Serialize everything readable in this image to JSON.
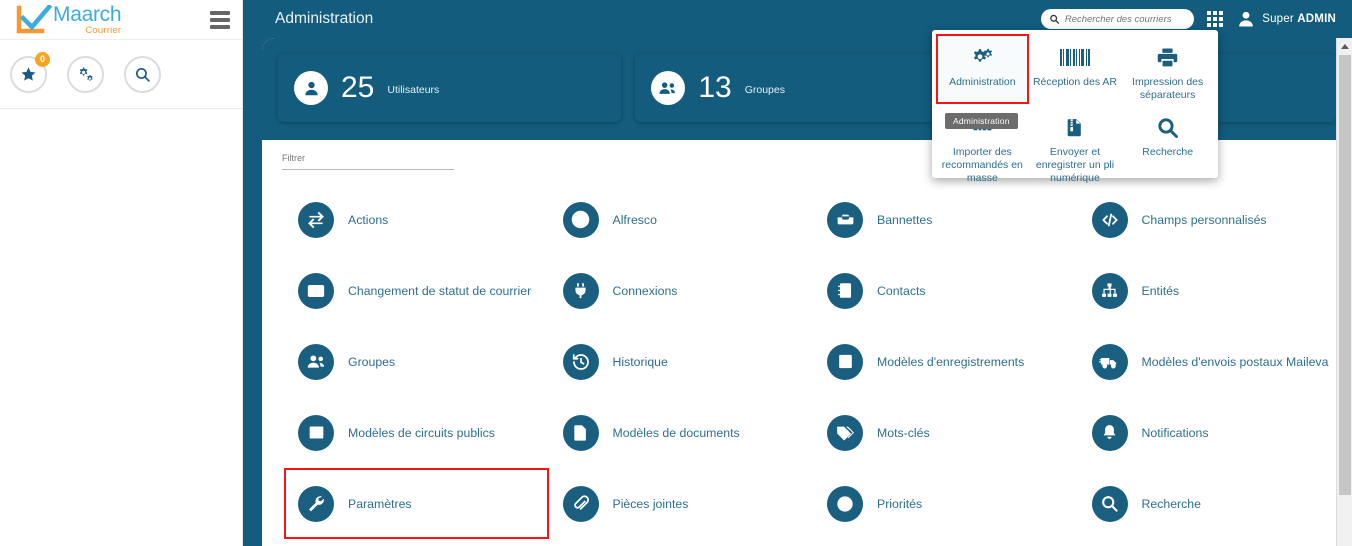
{
  "brand": {
    "name": "Maarch",
    "subtitle": "Courrier"
  },
  "sidebar": {
    "menu_icon": "hamburger-icon",
    "quick_actions": [
      {
        "name": "favorites-button",
        "icon": "star-icon",
        "badge": "0"
      },
      {
        "name": "admin-shortcut-button",
        "icon": "gears-icon",
        "badge": ""
      },
      {
        "name": "search-shortcut-button",
        "icon": "magnifier-icon",
        "badge": ""
      }
    ]
  },
  "header": {
    "title": "Administration",
    "search": {
      "placeholder": "Rechercher des courriers",
      "value": ""
    },
    "apps_icon": "grid-apps-icon",
    "user": {
      "first": "Super ",
      "last": "ADMIN",
      "avatar_icon": "user-avatar-icon"
    }
  },
  "stats": [
    {
      "icon": "single-user-icon",
      "count": "25",
      "label": "Utilisateurs"
    },
    {
      "icon": "group-users-icon",
      "count": "13",
      "label": "Groupes"
    },
    {
      "icon": "",
      "count": "",
      "label": ""
    }
  ],
  "filter": {
    "placeholder": "Filtrer",
    "value": ""
  },
  "dropdown": {
    "tooltip": "Administration",
    "items": [
      {
        "label": "Administration",
        "icon": "gears-icon",
        "highlighted": true
      },
      {
        "label": "Réception des AR",
        "icon": "barcode-icon",
        "highlighted": false
      },
      {
        "label": "Impression des séparateurs",
        "icon": "printer-icon",
        "highlighted": false
      },
      {
        "label": "Importer des recommandés en masse",
        "icon": "registered-mail-icon",
        "highlighted": false
      },
      {
        "label": "Envoyer et enregistrer un pli numérique",
        "icon": "zipped-document-icon",
        "highlighted": false
      },
      {
        "label": "Recherche",
        "icon": "magnifier-icon",
        "highlighted": false
      }
    ]
  },
  "admin_items": [
    {
      "label": "Actions",
      "icon": "exchange-arrows-icon",
      "highlighted": false
    },
    {
      "label": "Alfresco",
      "icon": "alfresco-flower-icon",
      "highlighted": false
    },
    {
      "label": "Bannettes",
      "icon": "inbox-tray-icon",
      "highlighted": false
    },
    {
      "label": "Champs personnalisés",
      "icon": "code-brackets-icon",
      "highlighted": false
    },
    {
      "label": "Changement de statut de courrier",
      "icon": "envelope-icon",
      "highlighted": false
    },
    {
      "label": "Connexions",
      "icon": "power-plug-icon",
      "highlighted": false
    },
    {
      "label": "Contacts",
      "icon": "address-book-icon",
      "highlighted": false
    },
    {
      "label": "Entités",
      "icon": "org-chart-icon",
      "highlighted": false
    },
    {
      "label": "Groupes",
      "icon": "group-users-icon",
      "highlighted": false
    },
    {
      "label": "Historique",
      "icon": "history-clock-icon",
      "highlighted": false
    },
    {
      "label": "Modèles d'enregistrements",
      "icon": "form-template-icon",
      "highlighted": false
    },
    {
      "label": "Modèles d'envois postaux Maileva",
      "icon": "delivery-truck-icon",
      "highlighted": false
    },
    {
      "label": "Modèles de circuits publics",
      "icon": "table-grid-icon",
      "highlighted": false
    },
    {
      "label": "Modèles de documents",
      "icon": "document-icon",
      "highlighted": false
    },
    {
      "label": "Mots-clés",
      "icon": "tags-icon",
      "highlighted": false
    },
    {
      "label": "Notifications",
      "icon": "bell-icon",
      "highlighted": false
    },
    {
      "label": "Paramètres",
      "icon": "wrench-icon",
      "highlighted": true
    },
    {
      "label": "Pièces jointes",
      "icon": "paperclip-icon",
      "highlighted": false
    },
    {
      "label": "Priorités",
      "icon": "clock-icon",
      "highlighted": false
    },
    {
      "label": "Recherche",
      "icon": "magnifier-icon",
      "highlighted": false
    }
  ],
  "colors": {
    "header_bg": "#135c7d",
    "accent_blue": "#1a5f80",
    "label_blue": "#2e6f8e",
    "logo_blue": "#3cacdf",
    "logo_orange": "#f99830",
    "badge_orange": "#f5a623",
    "highlight_red": "#f61414"
  }
}
